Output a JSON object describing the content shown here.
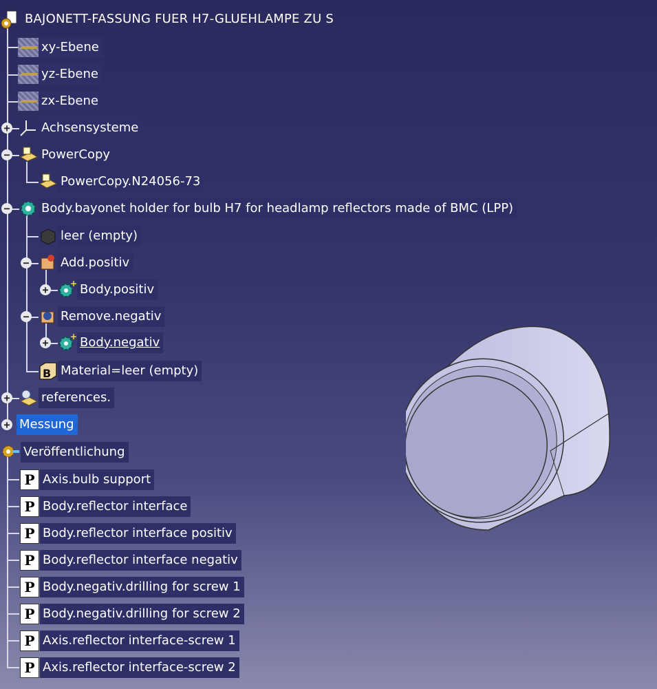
{
  "tree": {
    "root_title": "BAJONETT-FASSUNG FUER H7-GLUEHLAMPE ZU S",
    "planes": [
      {
        "label": "xy-Ebene"
      },
      {
        "label": "yz-Ebene"
      },
      {
        "label": "zx-Ebene"
      }
    ],
    "axis_systems": {
      "label": "Achsensysteme"
    },
    "powercopy": {
      "label": "PowerCopy",
      "child": "PowerCopy.N24056-73"
    },
    "body": {
      "label": "Body.bayonet holder for bulb H7 for headlamp reflectors made of BMC (LPP)",
      "leer": "leer (empty)",
      "add": "Add.positiv",
      "add_child": "Body.positiv",
      "remove": "Remove.negativ",
      "remove_child": "Body.negativ",
      "material": "Material=leer (empty)"
    },
    "references": {
      "label": "references."
    },
    "messung": {
      "label": "Messung"
    },
    "publication": {
      "label": "Veröffentlichung",
      "items": [
        "Axis.bulb support",
        "Body.reflector interface",
        "Body.reflector interface positiv",
        "Body.reflector interface negativ",
        "Body.negativ.drilling for screw 1",
        "Body.negativ.drilling for screw 2",
        "Axis.reflector interface-screw 1",
        "Axis.reflector interface-screw 2"
      ]
    }
  },
  "icons": {
    "root": "product-gear-icon",
    "plane": "plane-icon",
    "axis": "axis-system-icon",
    "powercopy": "powercopy-icon",
    "body": "body-gears-icon",
    "add": "add-boolean-icon",
    "remove": "remove-boolean-icon",
    "material": "material-icon",
    "publication": "publication-icon"
  },
  "colors": {
    "background_top": "#2a2a5e",
    "background_bottom": "#8a8aae",
    "label_bg": "#2e2f66",
    "selected_bg": "#1f66d6"
  }
}
